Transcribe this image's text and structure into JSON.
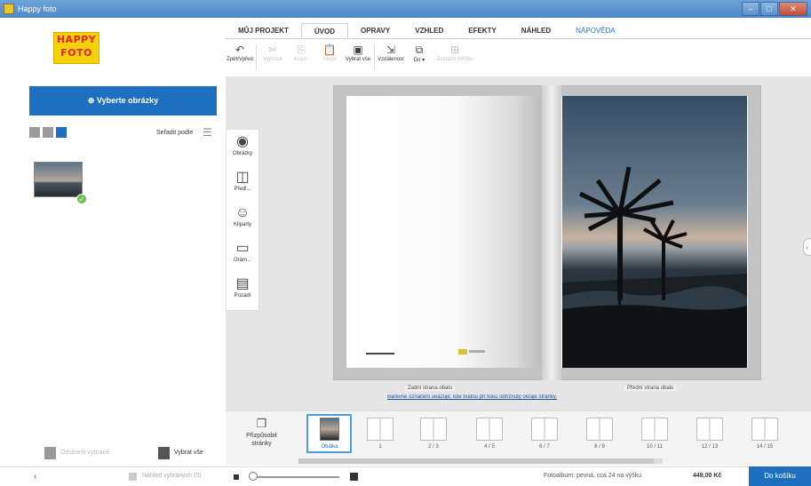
{
  "window": {
    "title": "Happy foto"
  },
  "logo": {
    "line1": "HAPPY",
    "line2": "FOTO"
  },
  "tabs": [
    {
      "label": "MŮJ PROJEKT"
    },
    {
      "label": "ÚVOD"
    },
    {
      "label": "OPRAVY"
    },
    {
      "label": "VZHLED"
    },
    {
      "label": "EFEKTY"
    },
    {
      "label": "NÁHLED"
    },
    {
      "label": "NÁPOVĚDA"
    }
  ],
  "toolbar": [
    {
      "icon": "undo-icon",
      "glyph": "↶",
      "label": "Zpět/Vpřed"
    },
    {
      "icon": "cut-icon",
      "glyph": "✂",
      "label": "Vyjmout"
    },
    {
      "icon": "copy-icon",
      "glyph": "⎘",
      "label": "Kopír."
    },
    {
      "icon": "paste-icon",
      "glyph": "📋",
      "label": "Vložit"
    },
    {
      "icon": "layout-icon",
      "glyph": "▣",
      "label": "Vybrat vše"
    },
    {
      "icon": "arrange-icon",
      "glyph": "⇲",
      "label": "Vzdálenost"
    },
    {
      "icon": "align-icon",
      "glyph": "⧉",
      "label": "Do ▾"
    },
    {
      "icon": "grid-icon",
      "glyph": "⊞",
      "label": "Zobrazit mřížku"
    }
  ],
  "sidebar": {
    "select_button": "⊕ Vyberte obrázky",
    "sort_label": "Seřadit podle",
    "bottom_left_label": "Odstranit vybrané",
    "bottom_right_label": "Vybrat vše"
  },
  "tools": [
    {
      "icon": "camera-icon",
      "glyph": "◉",
      "label": "Obrázky"
    },
    {
      "icon": "layout-icon",
      "glyph": "◫",
      "label": "Předl..."
    },
    {
      "icon": "smiley-icon",
      "glyph": "☺",
      "label": "Kliparty"
    },
    {
      "icon": "frame-icon",
      "glyph": "▭",
      "label": "Orám..."
    },
    {
      "icon": "background-icon",
      "glyph": "▤",
      "label": "Pozadí"
    }
  ],
  "spread": {
    "left_page_label": "Zadní strana obalu",
    "right_page_label": "Přední strana obalu",
    "notice": "Barevné označení ukazuje, kde budou při tisku odříznuty okraje stránky."
  },
  "strip": {
    "add_pages": "Přizpůsobit stránky",
    "cover_label": "Obálka",
    "pages": [
      "1",
      "2 / 3",
      "4 / 5",
      "6 / 7",
      "8 / 9",
      "10 / 11",
      "12 / 13",
      "14 / 15"
    ]
  },
  "statusbar": {
    "view_label": "Náhled vybraných (0)",
    "info": "Fotoalbum: pevná, cca 24 na výšku",
    "price": "449,00 Kč",
    "cart_button": "Do košíku"
  },
  "colors": {
    "accent": "#1f6fc1",
    "logo_yellow": "#f4d20a",
    "logo_red": "#e3242b"
  }
}
